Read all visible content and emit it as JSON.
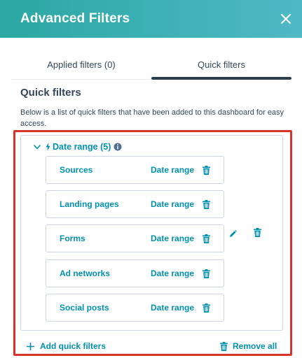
{
  "colors": {
    "header_start": "#2aa8a2",
    "header_end": "#4fb8c6",
    "link": "#0091ae",
    "text": "#33475b",
    "highlight_frame": "#d9342b",
    "border": "#cbd6e2"
  },
  "header": {
    "title": "Advanced Filters",
    "close_icon": "close-icon"
  },
  "tabs": [
    {
      "label": "Applied filters (0)",
      "active": false
    },
    {
      "label": "Quick filters",
      "active": true
    }
  ],
  "section": {
    "title": "Quick filters",
    "description": "Below is a list of quick filters that have been added to this dashboard for easy access."
  },
  "group": {
    "label": "Date range (5)",
    "icons": [
      "chevron-down-icon",
      "bolt-icon",
      "info-icon",
      "pencil-icon",
      "trash-icon"
    ],
    "filters": [
      {
        "name": "Sources",
        "type": "Date range"
      },
      {
        "name": "Landing pages",
        "type": "Date range"
      },
      {
        "name": "Forms",
        "type": "Date range"
      },
      {
        "name": "Ad networks",
        "type": "Date range"
      },
      {
        "name": "Social posts",
        "type": "Date range"
      }
    ]
  },
  "footer": {
    "add_label": "Add quick filters",
    "remove_label": "Remove all"
  }
}
